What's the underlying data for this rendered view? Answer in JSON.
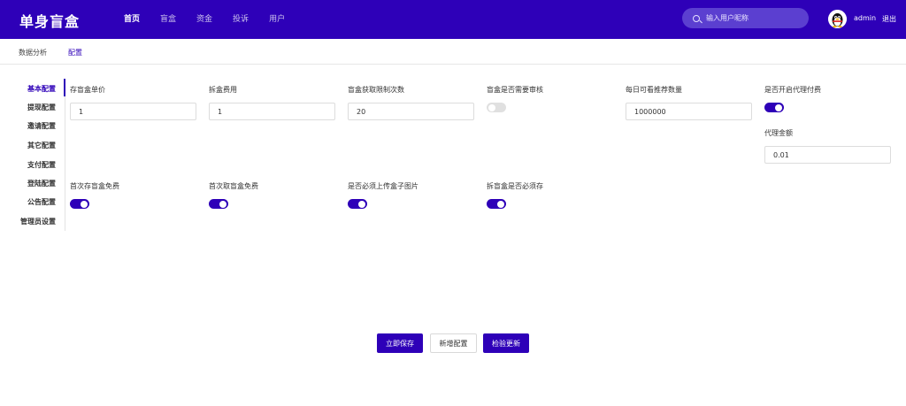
{
  "header": {
    "logo": "单身盲盒",
    "nav": [
      "首页",
      "盲盒",
      "资金",
      "投诉",
      "用户"
    ],
    "search_placeholder": "输入用户昵称",
    "username": "admin",
    "logout": "退出"
  },
  "subtabs": [
    "数据分析",
    "配置"
  ],
  "sidebar": {
    "items": [
      "基本配置",
      "提现配置",
      "邀请配置",
      "其它配置",
      "支付配置",
      "登陆配置",
      "公告配置",
      "管理员设置"
    ]
  },
  "form": {
    "box_price": {
      "label": "存盲盒单价",
      "value": "1"
    },
    "open_fee": {
      "label": "拆盒费用",
      "value": "1"
    },
    "fetch_limit": {
      "label": "盲盒获取限制次数",
      "value": "20"
    },
    "need_review": {
      "label": "盲盒是否需要审核",
      "on": false
    },
    "daily_recommend": {
      "label": "每日可看推荐数量",
      "value": "1000000"
    },
    "agent_pay": {
      "label": "是否开启代理付费",
      "on": true
    },
    "agent_amount": {
      "label": "代理金额",
      "value": "0.01"
    },
    "first_store_free": {
      "label": "首次存盲盒免费",
      "on": true
    },
    "first_take_free": {
      "label": "首次取盲盒免费",
      "on": true
    },
    "must_upload_photo": {
      "label": "是否必须上传盒子图片",
      "on": true
    },
    "must_store_to_open": {
      "label": "拆盲盒是否必须存",
      "on": true
    }
  },
  "buttons": {
    "save": "立即保存",
    "add": "新增配置",
    "check_update": "检验更新"
  },
  "colors": {
    "primary": "#2e00b8",
    "search_bg": "#5b3fd0"
  }
}
